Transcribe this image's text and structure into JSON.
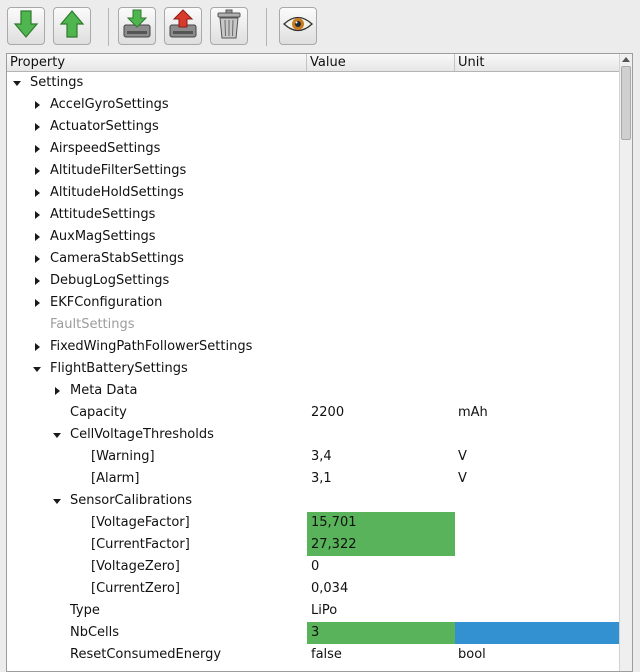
{
  "toolbar": {
    "buttons": [
      {
        "icon": "arrow-down-green-icon"
      },
      {
        "icon": "arrow-up-green-icon"
      },
      {
        "icon": "save-to-flash-icon"
      },
      {
        "icon": "load-from-flash-icon"
      },
      {
        "icon": "trash-icon"
      },
      {
        "icon": "eye-icon"
      }
    ]
  },
  "tree": {
    "columns": [
      "Property",
      "Value",
      "Unit"
    ],
    "rows": [
      {
        "label": "Settings",
        "value": "",
        "unit": "",
        "expanded": true
      },
      {
        "label": "AccelGyroSettings",
        "value": "",
        "unit": ""
      },
      {
        "label": "ActuatorSettings",
        "value": "",
        "unit": ""
      },
      {
        "label": "AirspeedSettings",
        "value": "",
        "unit": ""
      },
      {
        "label": "AltitudeFilterSettings",
        "value": "",
        "unit": ""
      },
      {
        "label": "AltitudeHoldSettings",
        "value": "",
        "unit": ""
      },
      {
        "label": "AttitudeSettings",
        "value": "",
        "unit": ""
      },
      {
        "label": "AuxMagSettings",
        "value": "",
        "unit": ""
      },
      {
        "label": "CameraStabSettings",
        "value": "",
        "unit": ""
      },
      {
        "label": "DebugLogSettings",
        "value": "",
        "unit": ""
      },
      {
        "label": "EKFConfiguration",
        "value": "",
        "unit": ""
      },
      {
        "label": "FaultSettings",
        "value": "",
        "unit": "",
        "disabled": true
      },
      {
        "label": "FixedWingPathFollowerSettings",
        "value": "",
        "unit": ""
      },
      {
        "label": "FlightBatterySettings",
        "value": "",
        "unit": "",
        "expanded": true
      },
      {
        "label": "Meta Data",
        "value": "",
        "unit": ""
      },
      {
        "label": "Capacity",
        "value": "2200",
        "unit": "mAh"
      },
      {
        "label": "CellVoltageThresholds",
        "value": "",
        "unit": "",
        "expanded": true
      },
      {
        "label": "[Warning]",
        "value": "3,4",
        "unit": "V"
      },
      {
        "label": "[Alarm]",
        "value": "3,1",
        "unit": "V"
      },
      {
        "label": "SensorCalibrations",
        "value": "",
        "unit": "",
        "expanded": true
      },
      {
        "label": "[VoltageFactor]",
        "value": "15,701",
        "unit": "",
        "value_highlight": "#59b35a"
      },
      {
        "label": "[CurrentFactor]",
        "value": "27,322",
        "unit": "",
        "value_highlight": "#59b35a"
      },
      {
        "label": "[VoltageZero]",
        "value": "0",
        "unit": ""
      },
      {
        "label": "[CurrentZero]",
        "value": "0,034",
        "unit": ""
      },
      {
        "label": "Type",
        "value": "LiPo",
        "unit": ""
      },
      {
        "label": "NbCells",
        "value": "3",
        "unit": "",
        "value_highlight": "#59b35a",
        "unit_highlight": "#3391d1"
      },
      {
        "label": "ResetConsumedEnergy",
        "value": "false",
        "unit": "bool"
      }
    ]
  }
}
